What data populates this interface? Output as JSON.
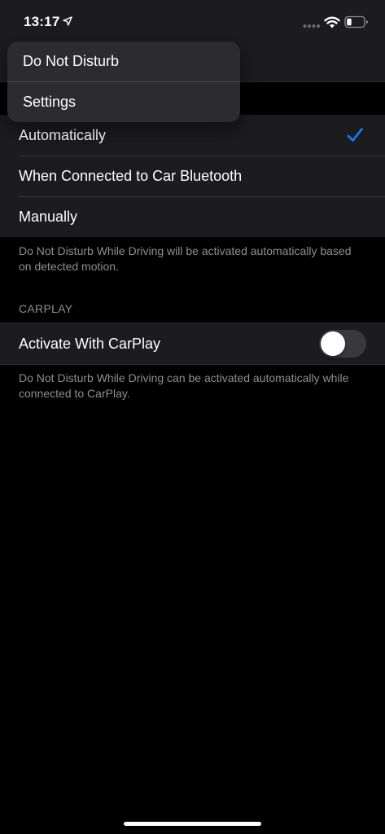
{
  "status_bar": {
    "time": "13:17"
  },
  "context_menu": {
    "items": [
      {
        "label": "Do Not Disturb"
      },
      {
        "label": "Settings"
      }
    ]
  },
  "activate_options": {
    "items": [
      {
        "label": "Automatically",
        "selected": true
      },
      {
        "label": "When Connected to Car Bluetooth",
        "selected": false
      },
      {
        "label": "Manually",
        "selected": false
      }
    ],
    "footer": "Do Not Disturb While Driving will be activated automatically based on detected motion."
  },
  "carplay": {
    "header": "CARPLAY",
    "row_label": "Activate With CarPlay",
    "toggle_on": false,
    "footer": "Do Not Disturb While Driving can be activated automatically while connected to CarPlay."
  },
  "colors": {
    "accent": "#0a84ff",
    "background": "#000000",
    "group_background": "#1c1c1e",
    "secondary_text": "#8e8e93"
  },
  "icons": [
    "location-arrow-icon",
    "cellular-signal-icon",
    "wifi-icon",
    "battery-icon",
    "checkmark-icon"
  ]
}
